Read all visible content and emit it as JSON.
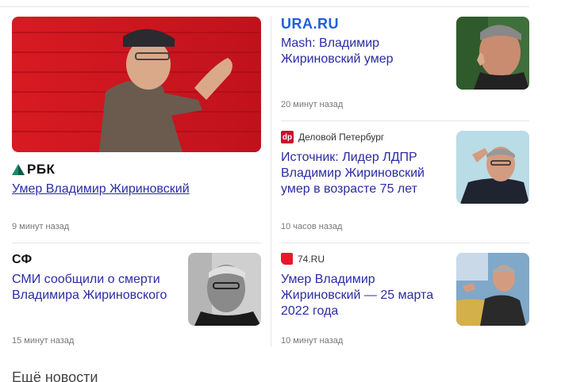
{
  "news": [
    {
      "source": "РБК",
      "source_icon": "rbc-logo-icon",
      "title": "Умер Владимир Жириновский",
      "time": "9 минут назад"
    },
    {
      "source": "URA.RU",
      "source_icon": "ura-logo-icon",
      "title": "Mash: Владимир Жириновский умер",
      "time": "20 минут назад"
    },
    {
      "source": "Деловой Петербург",
      "source_icon": "dp-logo-icon",
      "source_icon_text": "dp",
      "title": "Источник: Лидер ЛДПР Владимир Жириновский умер в возрасте 75 лет",
      "time": "10 часов назад"
    },
    {
      "source": "СФ",
      "source_icon": "sf-logo-icon",
      "title": "СМИ сообщили о смерти Владимира Жириновского",
      "time": "15 минут назад"
    },
    {
      "source": "74.RU",
      "source_icon": "74ru-logo-icon",
      "title": "Умер Владимир Жириновский — 25 марта 2022 года",
      "time": "10 минут назад"
    }
  ],
  "more_news_label": "Ещё новости",
  "colors": {
    "link": "#2b2ba5",
    "rbc_accent": "#1a8a6e",
    "ura": "#1e5fd8",
    "dp": "#c8102e",
    "ru74": "#e6192b"
  }
}
